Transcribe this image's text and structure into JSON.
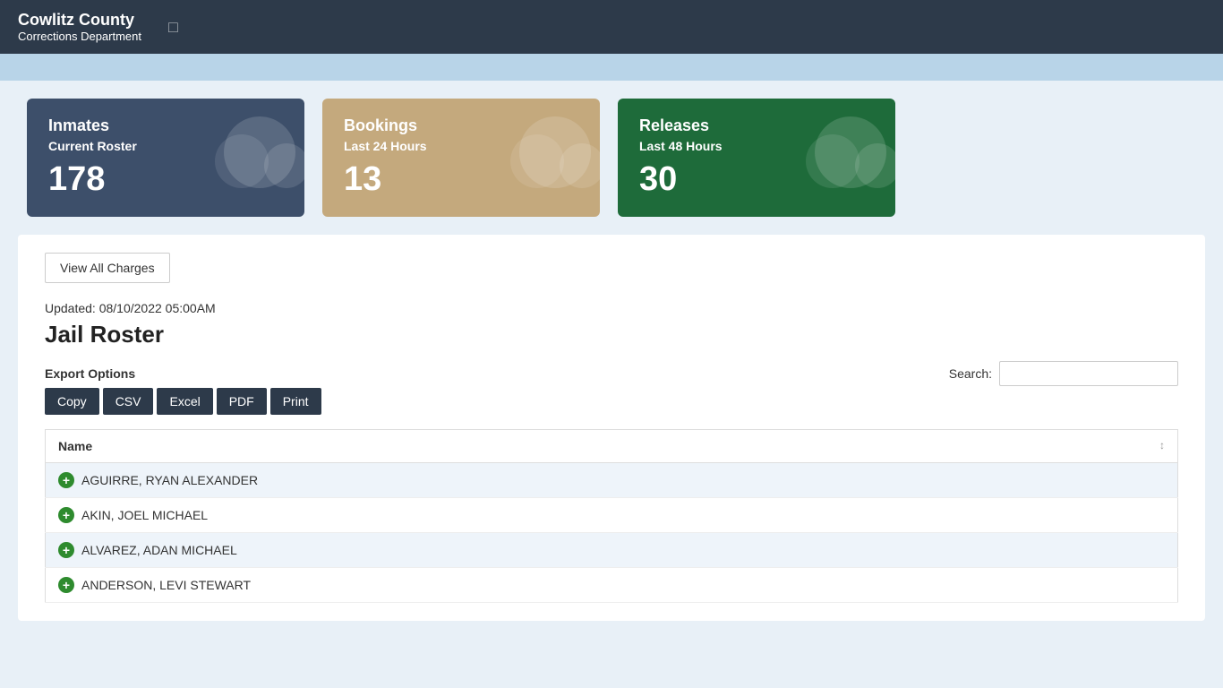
{
  "header": {
    "title": "Cowlitz County",
    "subtitle": "Corrections Department"
  },
  "stats": {
    "inmates": {
      "title": "Inmates",
      "subtitle": "Current Roster",
      "number": "178"
    },
    "bookings": {
      "title": "Bookings",
      "subtitle": "Last 24 Hours",
      "number": "13"
    },
    "releases": {
      "title": "Releases",
      "subtitle": "Last 48 Hours",
      "number": "30"
    }
  },
  "main": {
    "view_all_charges_label": "View All Charges",
    "updated_text": "Updated: 08/10/2022 05:00AM",
    "roster_title": "Jail Roster",
    "export_label": "Export Options",
    "export_buttons": [
      "Copy",
      "CSV",
      "Excel",
      "PDF",
      "Print"
    ],
    "search_label": "Search:",
    "search_placeholder": "",
    "table": {
      "column": "Name",
      "rows": [
        "AGUIRRE, RYAN ALEXANDER",
        "AKIN, JOEL MICHAEL",
        "ALVAREZ, ADAN MICHAEL",
        "ANDERSON, LEVI STEWART"
      ]
    }
  }
}
